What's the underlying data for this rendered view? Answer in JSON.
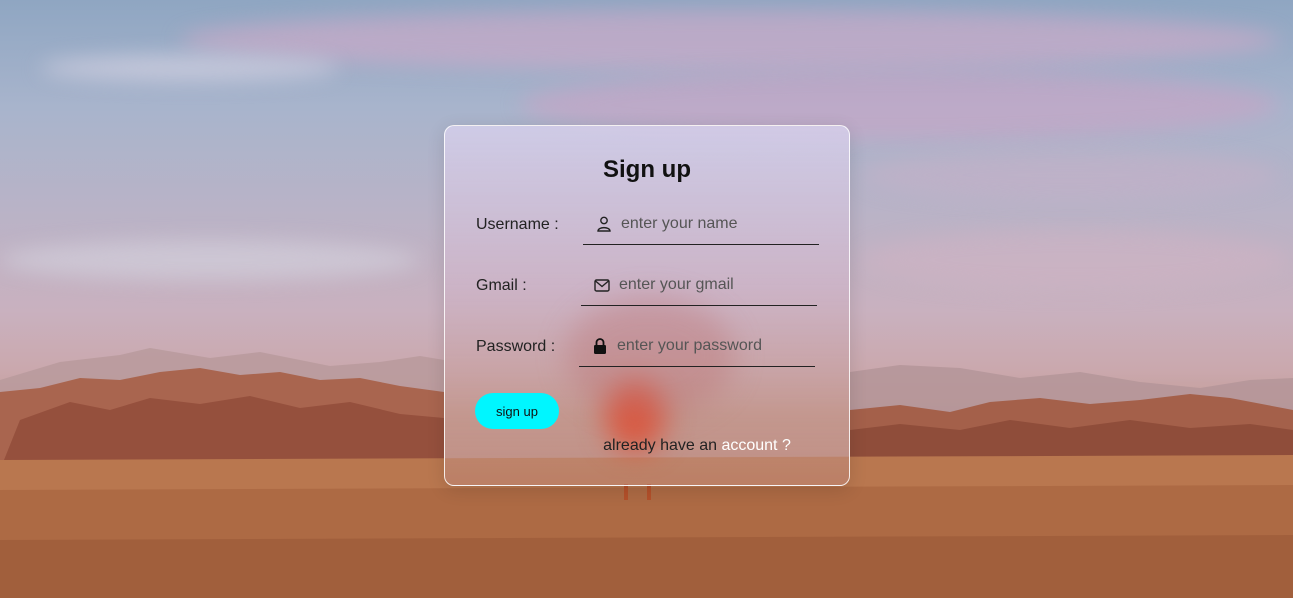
{
  "form": {
    "title": "Sign up",
    "username": {
      "label": "Username :",
      "placeholder": "enter your name",
      "icon": "user-icon"
    },
    "gmail": {
      "label": "Gmail :",
      "placeholder": "enter your gmail",
      "icon": "envelope-icon"
    },
    "password": {
      "label": "Password :",
      "placeholder": "enter your password",
      "icon": "lock-icon"
    },
    "submit_label": "sign up",
    "footer_text": "already have an",
    "footer_link": "account ?"
  },
  "colors": {
    "button": "#00f6ff",
    "link": "#ffffff"
  }
}
